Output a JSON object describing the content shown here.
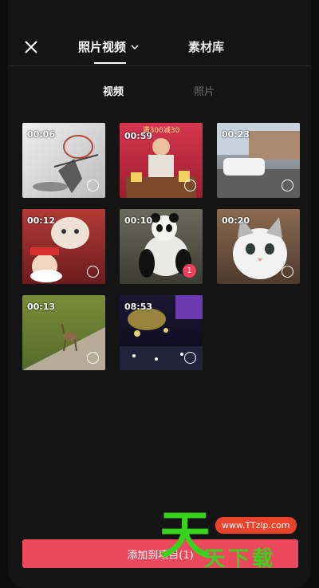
{
  "header": {
    "tab_active": "照片视频",
    "tab_other": "素材库"
  },
  "subtabs": {
    "active": "视频",
    "inactive": "照片"
  },
  "grid": {
    "items": [
      {
        "duration": "00:06",
        "caption": ""
      },
      {
        "duration": "00:59",
        "caption": "满300减30",
        "selected_index": ""
      },
      {
        "duration": "00:23",
        "caption": ""
      },
      {
        "duration": "00:12",
        "caption": ""
      },
      {
        "duration": "00:10",
        "caption": "",
        "selected_index": "1"
      },
      {
        "duration": "00:20",
        "caption": ""
      },
      {
        "duration": "00:13",
        "caption": ""
      },
      {
        "duration": "08:53",
        "caption": ""
      }
    ]
  },
  "bottom_button": {
    "label": "添加到项目(1)"
  },
  "watermark": {
    "url": "www.TTzip.com",
    "big_char": "天",
    "text": "天下载"
  }
}
